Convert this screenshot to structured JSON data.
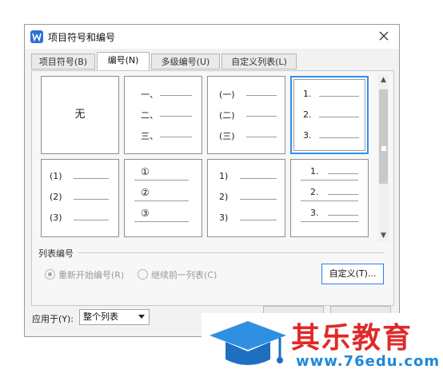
{
  "window": {
    "title": "项目符号和编号",
    "close_icon": "close-icon",
    "app_icon": "wps-writer-icon"
  },
  "tabs": [
    {
      "label": "项目符号(B)",
      "active": false
    },
    {
      "label": "编号(N)",
      "active": true
    },
    {
      "label": "多级编号(U)",
      "active": false
    },
    {
      "label": "自定义列表(L)",
      "active": false
    }
  ],
  "styles": [
    {
      "none_label": "无"
    },
    {
      "items": [
        "一、",
        "二、",
        "三、"
      ]
    },
    {
      "items": [
        "(一)",
        "(二)",
        "(三)"
      ]
    },
    {
      "items": [
        "1.",
        "2.",
        "3."
      ],
      "selected": true
    },
    {
      "items": [
        "(1)",
        "(2)",
        "(3)"
      ]
    },
    {
      "items": [
        "①",
        "②",
        "③"
      ]
    },
    {
      "items": [
        "1)",
        "2)",
        "3)"
      ]
    },
    {
      "items": [
        "1.",
        "2.",
        "3."
      ]
    }
  ],
  "list_numbering": {
    "section_label": "列表编号",
    "restart_label": "重新开始编号(R)",
    "continue_label": "继续前一列表(C)",
    "restart_selected": true,
    "customize_label": "自定义(T)..."
  },
  "apply": {
    "label": "应用于(Y):",
    "value": "整个列表"
  },
  "watermark": {
    "brand": "其乐教育",
    "url": "www.76edu.com"
  },
  "colors": {
    "accent": "#2e8ff0",
    "brand_red": "#e02a2a",
    "brand_blue": "#1e88d8"
  }
}
